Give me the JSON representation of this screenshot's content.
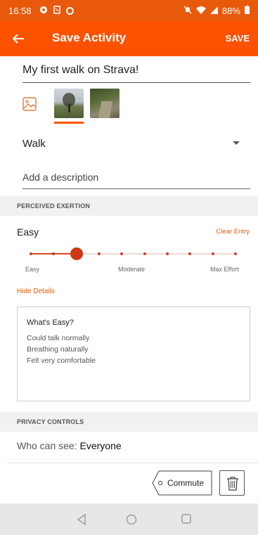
{
  "status_bar": {
    "time": "16:58",
    "battery": "88%",
    "left_icons": [
      "settings-icon",
      "sim-icon",
      "circle-icon"
    ],
    "right_icons": [
      "mute-icon",
      "wifi-icon",
      "signal-icon",
      "battery-icon"
    ]
  },
  "app_bar": {
    "title": "Save Activity",
    "action": "SAVE",
    "color": "#fc5200"
  },
  "activity": {
    "name": "My first walk on Strava!",
    "type": "Walk",
    "description_placeholder": "Add a description"
  },
  "media": {
    "add_icon": "image-icon",
    "thumbnails": [
      "photo-1",
      "photo-2"
    ],
    "selected_index": 0
  },
  "perceived_exertion": {
    "section_title": "PERCEIVED EXERTION",
    "selected_label": "Easy",
    "clear_label": "Clear Entry",
    "slider_steps": 10,
    "slider_value": 3,
    "scale_labels": [
      "Easy",
      "Moderate",
      "Max Effort"
    ],
    "hide_details_label": "Hide Details",
    "details": {
      "heading": "What's Easy?",
      "lines": [
        "Could talk normally",
        "Breathing naturally",
        "Felt very comfortable"
      ]
    }
  },
  "privacy": {
    "section_title": "PRIVACY CONTROLS",
    "label": "Who can see:",
    "value": "Everyone"
  },
  "actions": {
    "commute_label": "Commute",
    "delete_icon": "trash-icon"
  },
  "nav_bar": {
    "buttons": [
      "back-triangle-icon",
      "home-circle-icon",
      "recents-square-icon"
    ]
  }
}
